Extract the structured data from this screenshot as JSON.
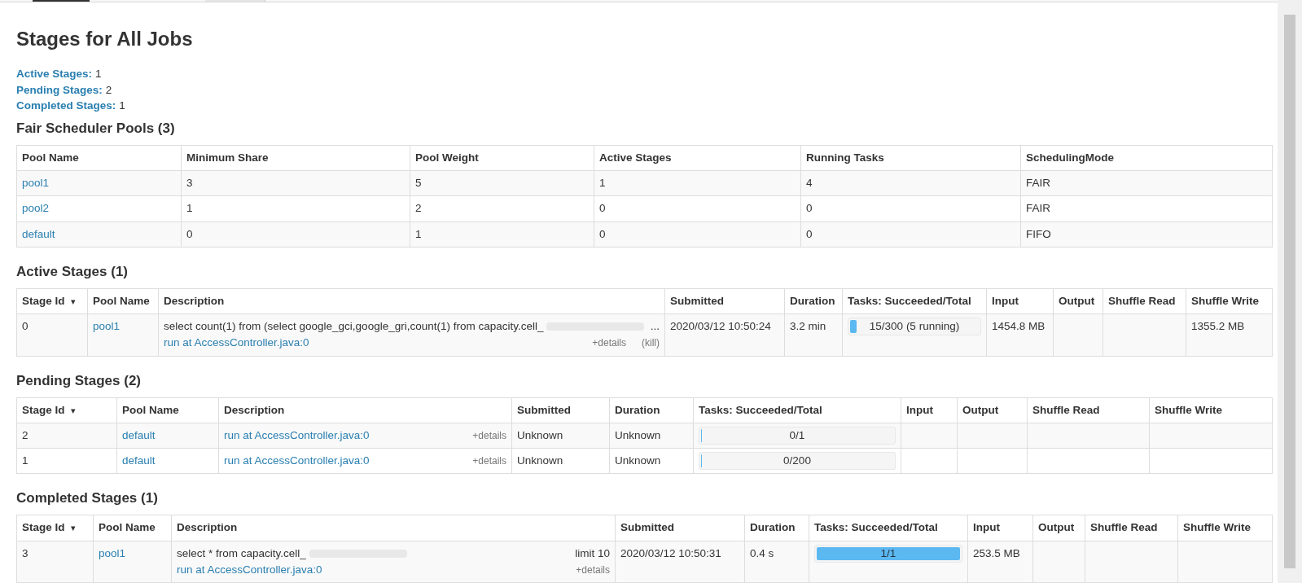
{
  "page_title": "Stages for All Jobs",
  "summary": [
    {
      "label": "Active Stages:",
      "value": "1"
    },
    {
      "label": "Pending Stages:",
      "value": "2"
    },
    {
      "label": "Completed Stages:",
      "value": "1"
    }
  ],
  "pools": {
    "title": "Fair Scheduler Pools (3)",
    "columns": [
      "Pool Name",
      "Minimum Share",
      "Pool Weight",
      "Active Stages",
      "Running Tasks",
      "SchedulingMode"
    ],
    "rows": [
      {
        "name": "pool1",
        "minimum_share": "3",
        "pool_weight": "5",
        "active_stages": "1",
        "running_tasks": "4",
        "scheduling_mode": "FAIR"
      },
      {
        "name": "pool2",
        "minimum_share": "1",
        "pool_weight": "2",
        "active_stages": "0",
        "running_tasks": "0",
        "scheduling_mode": "FAIR"
      },
      {
        "name": "default",
        "minimum_share": "0",
        "pool_weight": "1",
        "active_stages": "0",
        "running_tasks": "0",
        "scheduling_mode": "FIFO"
      }
    ]
  },
  "stage_tables": [
    {
      "title": "Active Stages (1)",
      "columns": [
        {
          "label": "Stage Id",
          "sort_indicator": "▾"
        },
        {
          "label": "Pool Name"
        },
        {
          "label": "Description"
        },
        {
          "label": "Submitted"
        },
        {
          "label": "Duration"
        },
        {
          "label": "Tasks: Succeeded/Total"
        },
        {
          "label": "Input"
        },
        {
          "label": "Output"
        },
        {
          "label": "Shuffle Read"
        },
        {
          "label": "Shuffle Write"
        }
      ],
      "rows": [
        {
          "stage_id": "0",
          "pool": "pool1",
          "description": {
            "query": "select count(1) from (select google_gci,google_gri,count(1) from capacity.cell_",
            "query_end": "...",
            "link": "run at AccessController.java:0",
            "details": "+details",
            "kill": "(kill)"
          },
          "submitted": "2020/03/12 10:50:24",
          "duration": "3.2 min",
          "tasks": {
            "label": "15/300 (5 running)",
            "level": 0.05
          },
          "input": "1454.8 MB",
          "shuffle_write": "1355.2 MB"
        }
      ]
    },
    {
      "title": "Pending Stages (2)",
      "columns": [
        {
          "label": "Stage Id",
          "sort_indicator": "▾"
        },
        {
          "label": "Pool Name"
        },
        {
          "label": "Description"
        },
        {
          "label": "Submitted"
        },
        {
          "label": "Duration"
        },
        {
          "label": "Tasks: Succeeded/Total"
        },
        {
          "label": "Input"
        },
        {
          "label": "Output"
        },
        {
          "label": "Shuffle Read"
        },
        {
          "label": "Shuffle Write"
        }
      ],
      "rows": [
        {
          "stage_id": "2",
          "pool": "default",
          "description": {
            "link": "run at AccessController.java:0",
            "details": "+details"
          },
          "submitted": "Unknown",
          "duration": "Unknown",
          "tasks": {
            "label": "0/1",
            "level": 0
          }
        },
        {
          "stage_id": "1",
          "pool": "default",
          "description": {
            "link": "run at AccessController.java:0",
            "details": "+details"
          },
          "submitted": "Unknown",
          "duration": "Unknown",
          "tasks": {
            "label": "0/200",
            "level": 0
          }
        }
      ]
    },
    {
      "title": "Completed Stages (1)",
      "columns": [
        {
          "label": "Stage Id",
          "sort_indicator": "▾"
        },
        {
          "label": "Pool Name"
        },
        {
          "label": "Description"
        },
        {
          "label": "Submitted"
        },
        {
          "label": "Duration"
        },
        {
          "label": "Tasks: Succeeded/Total"
        },
        {
          "label": "Input"
        },
        {
          "label": "Output"
        },
        {
          "label": "Shuffle Read"
        },
        {
          "label": "Shuffle Write"
        }
      ],
      "rows": [
        {
          "stage_id": "3",
          "pool": "pool1",
          "description": {
            "query": "select * from capacity.cell_",
            "query_end": "limit 10",
            "link": "run at AccessController.java:0",
            "details": "+details"
          },
          "submitted": "2020/03/12 10:50:31",
          "duration": "0.4 s",
          "tasks": {
            "label": "1/1",
            "level": 1
          },
          "input": "253.5 MB"
        }
      ]
    }
  ]
}
